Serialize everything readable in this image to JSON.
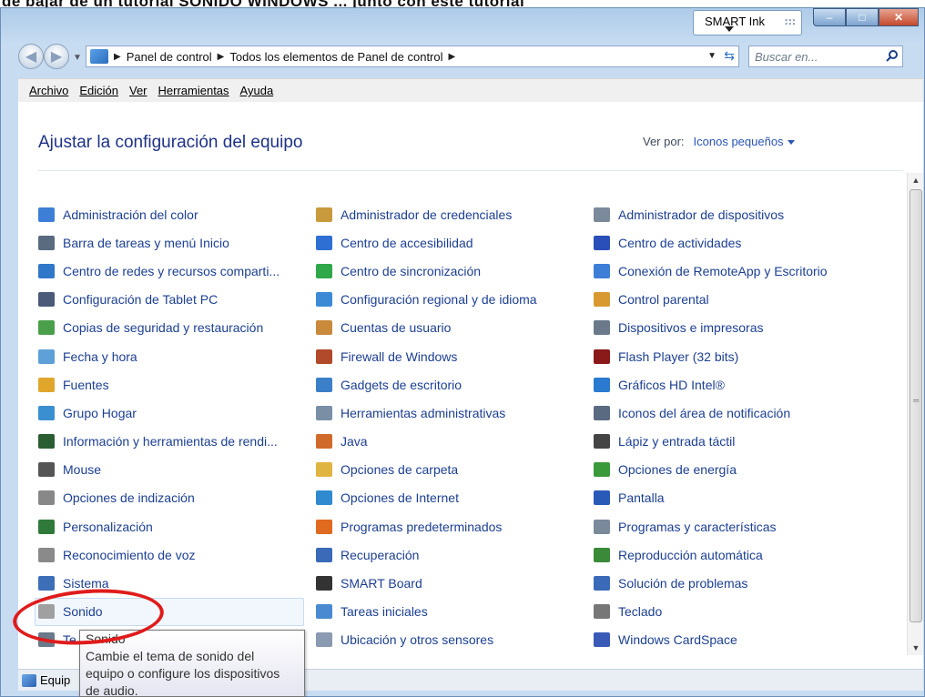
{
  "window": {
    "smart_ink_label": "SMART Ink",
    "controls": {
      "minimize": "–",
      "maximize": "□",
      "close": "✕"
    }
  },
  "address_bar": {
    "crumbs": [
      "Panel de control",
      "Todos los elementos de Panel de control"
    ],
    "search_placeholder": "Buscar en..."
  },
  "menu": [
    "Archivo",
    "Edición",
    "Ver",
    "Herramientas",
    "Ayuda"
  ],
  "content": {
    "title": "Ajustar la configuración del equipo",
    "view_by_label": "Ver por:",
    "view_by_value": "Iconos pequeños"
  },
  "items": {
    "col1": [
      {
        "label": "Administración del color",
        "icon": "color-management-icon",
        "color": "#3d7fd6"
      },
      {
        "label": "Barra de tareas y menú Inicio",
        "icon": "taskbar-icon",
        "color": "#5a6b80"
      },
      {
        "label": "Centro de redes y recursos comparti...",
        "icon": "network-center-icon",
        "color": "#2f77c8"
      },
      {
        "label": "Configuración de Tablet PC",
        "icon": "tablet-pc-icon",
        "color": "#4a5a78"
      },
      {
        "label": "Copias de seguridad y restauración",
        "icon": "backup-icon",
        "color": "#4aa04a"
      },
      {
        "label": "Fecha y hora",
        "icon": "date-time-icon",
        "color": "#5fa0d8"
      },
      {
        "label": "Fuentes",
        "icon": "fonts-icon",
        "color": "#e0a62c"
      },
      {
        "label": "Grupo Hogar",
        "icon": "homegroup-icon",
        "color": "#3a8fd0"
      },
      {
        "label": "Información y herramientas de rendi...",
        "icon": "performance-icon",
        "color": "#2b5d33"
      },
      {
        "label": "Mouse",
        "icon": "mouse-icon",
        "color": "#555555"
      },
      {
        "label": "Opciones de indización",
        "icon": "indexing-icon",
        "color": "#888888"
      },
      {
        "label": "Personalización",
        "icon": "personalization-icon",
        "color": "#2f7a3a"
      },
      {
        "label": "Reconocimiento de voz",
        "icon": "microphone-icon",
        "color": "#8a8a8a"
      },
      {
        "label": "Sistema",
        "icon": "system-icon",
        "color": "#3d6fb8"
      },
      {
        "label": "Sonido",
        "icon": "sound-icon",
        "color": "#a0a0a0"
      },
      {
        "label": "Te",
        "icon": "telephony-icon",
        "color": "#6a7a8a"
      }
    ],
    "col2": [
      {
        "label": "Administrador de credenciales",
        "icon": "credentials-icon",
        "color": "#c89a3c"
      },
      {
        "label": "Centro de accesibilidad",
        "icon": "accessibility-icon",
        "color": "#2d6fd2"
      },
      {
        "label": "Centro de sincronización",
        "icon": "sync-icon",
        "color": "#2fa84a"
      },
      {
        "label": "Configuración regional y de idioma",
        "icon": "region-language-icon",
        "color": "#3c8ad6"
      },
      {
        "label": "Cuentas de usuario",
        "icon": "user-accounts-icon",
        "color": "#c98a3c"
      },
      {
        "label": "Firewall de Windows",
        "icon": "firewall-icon",
        "color": "#b04a2a"
      },
      {
        "label": "Gadgets de escritorio",
        "icon": "gadgets-icon",
        "color": "#3b7fc8"
      },
      {
        "label": "Herramientas administrativas",
        "icon": "admin-tools-icon",
        "color": "#7a8fa6"
      },
      {
        "label": "Java",
        "icon": "java-icon",
        "color": "#d06a2a"
      },
      {
        "label": "Opciones de carpeta",
        "icon": "folder-options-icon",
        "color": "#e0b440"
      },
      {
        "label": "Opciones de Internet",
        "icon": "internet-options-icon",
        "color": "#2f8ad0"
      },
      {
        "label": "Programas predeterminados",
        "icon": "default-programs-icon",
        "color": "#e06a20"
      },
      {
        "label": "Recuperación",
        "icon": "recovery-icon",
        "color": "#3a6ab8"
      },
      {
        "label": "SMART Board",
        "icon": "smart-board-icon",
        "color": "#333333"
      },
      {
        "label": "Tareas iniciales",
        "icon": "getting-started-icon",
        "color": "#4a8ad0"
      },
      {
        "label": "Ubicación y otros sensores",
        "icon": "location-sensors-icon",
        "color": "#8a9ab0"
      }
    ],
    "col3": [
      {
        "label": "Administrador de dispositivos",
        "icon": "device-manager-icon",
        "color": "#7a8a9a"
      },
      {
        "label": "Centro de actividades",
        "icon": "action-center-icon",
        "color": "#2a4fb8"
      },
      {
        "label": "Conexión de RemoteApp y Escritorio",
        "icon": "remoteapp-icon",
        "color": "#3d7fd6"
      },
      {
        "label": "Control parental",
        "icon": "parental-control-icon",
        "color": "#d89a30"
      },
      {
        "label": "Dispositivos e impresoras",
        "icon": "devices-printers-icon",
        "color": "#6a7a8a"
      },
      {
        "label": "Flash Player (32 bits)",
        "icon": "flash-player-icon",
        "color": "#8a1a1a"
      },
      {
        "label": "Gráficos HD Intel®",
        "icon": "intel-graphics-icon",
        "color": "#2a7ad0"
      },
      {
        "label": "Iconos del área de notificación",
        "icon": "notification-area-icon",
        "color": "#5a6a80"
      },
      {
        "label": "Lápiz y entrada táctil",
        "icon": "pen-touch-icon",
        "color": "#444444"
      },
      {
        "label": "Opciones de energía",
        "icon": "power-options-icon",
        "color": "#3a9a3a"
      },
      {
        "label": "Pantalla",
        "icon": "display-icon",
        "color": "#2a5ab8"
      },
      {
        "label": "Programas y características",
        "icon": "programs-features-icon",
        "color": "#7a8a9a"
      },
      {
        "label": "Reproducción automática",
        "icon": "autoplay-icon",
        "color": "#3a8a3a"
      },
      {
        "label": "Solución de problemas",
        "icon": "troubleshooting-icon",
        "color": "#3a6ab8"
      },
      {
        "label": "Teclado",
        "icon": "keyboard-icon",
        "color": "#777777"
      },
      {
        "label": "Windows CardSpace",
        "icon": "cardspace-icon",
        "color": "#3a5ab8"
      }
    ]
  },
  "status_bar": {
    "text": "Equip"
  },
  "tooltip": {
    "title": "Sonido",
    "line1": "Cambie el tema de sonido del",
    "line2": "equipo o configure los dispositivos",
    "line3": "de audio."
  }
}
